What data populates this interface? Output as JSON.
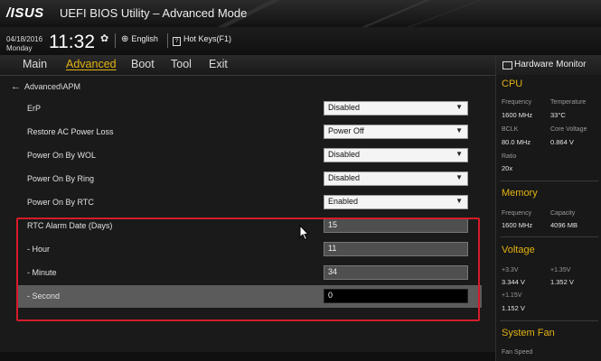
{
  "titlebar": {
    "logo": "/ISUS",
    "title": "UEFI BIOS Utility – Advanced Mode"
  },
  "infobar": {
    "date": "04/18/2016",
    "day": "Monday",
    "time": "11:32",
    "language": "English",
    "hotkeys": "Hot Keys(F1)"
  },
  "menu": {
    "items": [
      {
        "label": "Main",
        "active": false
      },
      {
        "label": "Advanced",
        "active": true
      },
      {
        "label": "Boot",
        "active": false
      },
      {
        "label": "Tool",
        "active": false
      },
      {
        "label": "Exit",
        "active": false
      }
    ]
  },
  "breadcrumb": "Advanced\\APM",
  "settings": [
    {
      "label": "ErP",
      "value": "Disabled",
      "type": "select"
    },
    {
      "label": "Restore AC Power Loss",
      "value": "Power Off",
      "type": "select"
    },
    {
      "label": "Power On By WOL",
      "value": "Disabled",
      "type": "select"
    },
    {
      "label": "Power On By Ring",
      "value": "Disabled",
      "type": "select"
    },
    {
      "label": "Power On By RTC",
      "value": "Enabled",
      "type": "select"
    },
    {
      "label": "RTC Alarm Date (Days)",
      "value": "15",
      "type": "number"
    },
    {
      "label": "- Hour",
      "value": "11",
      "type": "number"
    },
    {
      "label": "- Minute",
      "value": "34",
      "type": "number"
    },
    {
      "label": "- Second",
      "value": "0",
      "type": "number",
      "selected": true
    }
  ],
  "hardware_monitor": {
    "title": "Hardware Monitor",
    "cpu": {
      "heading": "CPU",
      "frequency_label": "Frequency",
      "frequency": "1600 MHz",
      "temperature_label": "Temperature",
      "temperature": "33°C",
      "bclk_label": "BCLK",
      "bclk": "80.0 MHz",
      "core_voltage_label": "Core Voltage",
      "core_voltage": "0.864 V",
      "ratio_label": "Ratio",
      "ratio": "20x"
    },
    "memory": {
      "heading": "Memory",
      "frequency_label": "Frequency",
      "frequency": "1600 MHz",
      "capacity_label": "Capacity",
      "capacity": "4096 MB"
    },
    "voltage": {
      "heading": "Voltage",
      "v33_label": "+3.3V",
      "v33": "3.344 V",
      "v135_label": "+1.35V",
      "v135": "1.352 V",
      "v115_label": "+1.15V",
      "v115": "1.152 V"
    },
    "fan": {
      "heading": "System Fan",
      "fan_speed_label": "Fan Speed"
    }
  },
  "colors": {
    "accent": "#e3b312",
    "highlight_box": "#d41c2a",
    "selected_row": "#5b5b5b"
  },
  "icons": {
    "settings": "gear-icon",
    "language": "globe-icon",
    "back": "arrow-left-icon",
    "monitor": "monitor-icon"
  }
}
